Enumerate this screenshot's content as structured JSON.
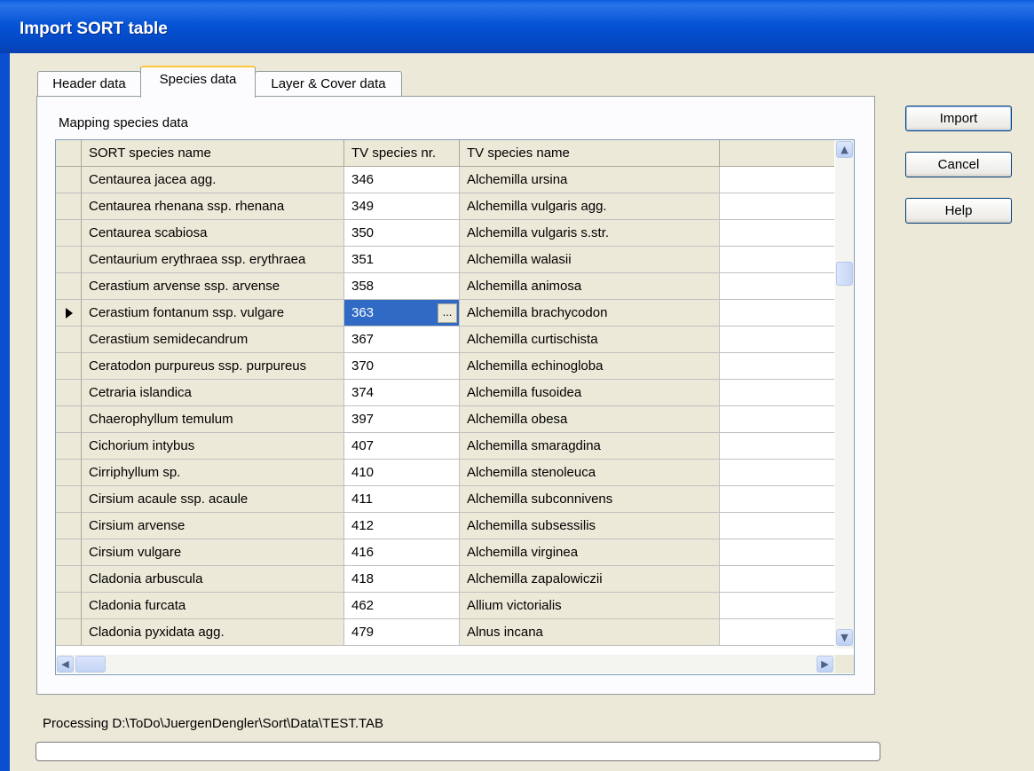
{
  "window": {
    "title": "Import SORT table"
  },
  "tabs": [
    "Header data",
    "Species data",
    "Layer & Cover data"
  ],
  "active_tab": "Species data",
  "section_label": "Mapping species data",
  "columns": [
    "SORT species name",
    "TV species nr.",
    "TV species name"
  ],
  "rows": [
    [
      "Centaurea jacea agg.",
      "346",
      "Alchemilla ursina"
    ],
    [
      "Centaurea rhenana ssp. rhenana",
      "349",
      "Alchemilla vulgaris agg."
    ],
    [
      "Centaurea scabiosa",
      "350",
      "Alchemilla vulgaris s.str."
    ],
    [
      "Centaurium erythraea ssp. erythraea",
      "351",
      "Alchemilla walasii"
    ],
    [
      "Cerastium arvense ssp. arvense",
      "358",
      "Alchemilla animosa"
    ],
    [
      "Cerastium fontanum ssp. vulgare",
      "363",
      "Alchemilla brachycodon"
    ],
    [
      "Cerastium semidecandrum",
      "367",
      "Alchemilla curtischista"
    ],
    [
      "Ceratodon purpureus ssp. purpureus",
      "370",
      "Alchemilla echinogloba"
    ],
    [
      "Cetraria islandica",
      "374",
      "Alchemilla fusoidea"
    ],
    [
      "Chaerophyllum temulum",
      "397",
      "Alchemilla obesa"
    ],
    [
      "Cichorium intybus",
      "407",
      "Alchemilla smaragdina"
    ],
    [
      "Cirriphyllum sp.",
      "410",
      "Alchemilla stenoleuca"
    ],
    [
      "Cirsium acaule ssp. acaule",
      "411",
      "Alchemilla subconnivens"
    ],
    [
      "Cirsium arvense",
      "412",
      "Alchemilla subsessilis"
    ],
    [
      "Cirsium vulgare",
      "416",
      "Alchemilla virginea"
    ],
    [
      "Cladonia arbuscula",
      "418",
      "Alchemilla zapalowiczii"
    ],
    [
      "Cladonia furcata",
      "462",
      "Allium victorialis"
    ],
    [
      "Cladonia pyxidata agg.",
      "479",
      "Alnus incana"
    ]
  ],
  "selected_row": 5,
  "ellipsis_label": "...",
  "buttons": {
    "import": "Import",
    "cancel": "Cancel",
    "help": "Help"
  },
  "processing_text": "Processing D:\\ToDo\\JuergenDengler\\Sort\\Data\\TEST.TAB",
  "colors": {
    "title_bar": "#0654d6",
    "selection": "#316ac5",
    "face": "#ece9d8"
  }
}
